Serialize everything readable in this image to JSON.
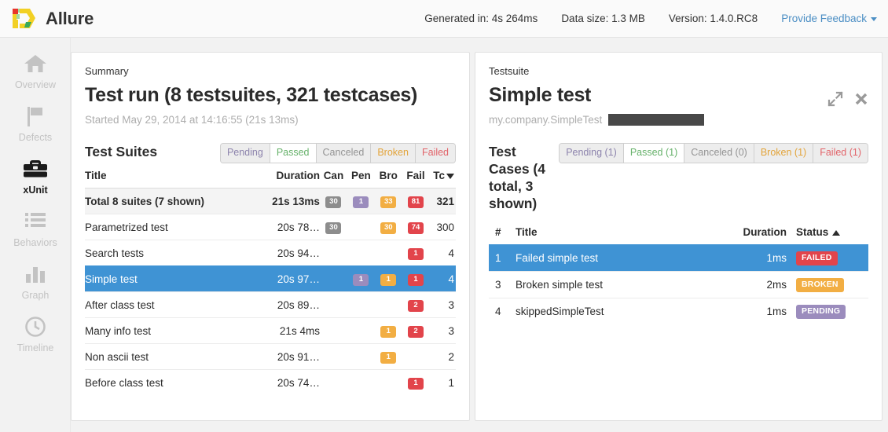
{
  "header": {
    "brand": "Allure",
    "logo_icon": "allure-logo-icon",
    "generated": "Generated in: 4s 264ms",
    "data_size": "Data size: 1.3 MB",
    "version": "Version: 1.4.0.RC8",
    "feedback": "Provide Feedback"
  },
  "sidebar": {
    "items": [
      {
        "label": "Overview",
        "icon": "home-icon",
        "active": false
      },
      {
        "label": "Defects",
        "icon": "flag-icon",
        "active": false
      },
      {
        "label": "xUnit",
        "icon": "briefcase-icon",
        "active": true
      },
      {
        "label": "Behaviors",
        "icon": "list-icon",
        "active": false
      },
      {
        "label": "Graph",
        "icon": "bar-chart-icon",
        "active": false
      },
      {
        "label": "Timeline",
        "icon": "clock-icon",
        "active": false
      }
    ]
  },
  "summary": {
    "eyebrow": "Summary",
    "title": "Test run (8 testsuites, 321 testcases)",
    "subtitle": "Started May 29, 2014 at 14:16:55 (21s 13ms)",
    "section_title": "Test Suites",
    "filters": [
      {
        "label": "Pending",
        "color": "#8d84ad",
        "active": false
      },
      {
        "label": "Passed",
        "color": "#67b26b",
        "active": true
      },
      {
        "label": "Canceled",
        "color": "#949494",
        "active": false
      },
      {
        "label": "Broken",
        "color": "#e3a43a",
        "active": false
      },
      {
        "label": "Failed",
        "color": "#e2646a",
        "active": false
      }
    ],
    "columns": [
      "Title",
      "Duration",
      "Can",
      "Pen",
      "Bro",
      "Fail",
      "Tc"
    ],
    "sort_column": "Tc",
    "sort_direction": "desc",
    "rows": [
      {
        "title": "Total 8 suites (7 shown)",
        "duration": "21s 13ms",
        "canceled": "30",
        "pending": "1",
        "broken": "33",
        "failed": "81",
        "total": "321",
        "total_row": true,
        "selected": false
      },
      {
        "title": "Parametrized test",
        "duration": "20s 78…",
        "canceled": "30",
        "pending": "",
        "broken": "30",
        "failed": "74",
        "total": "300",
        "total_row": false,
        "selected": false
      },
      {
        "title": "Search tests",
        "duration": "20s 94…",
        "canceled": "",
        "pending": "",
        "broken": "",
        "failed": "1",
        "total": "4",
        "total_row": false,
        "selected": false
      },
      {
        "title": "Simple test",
        "duration": "20s 97…",
        "canceled": "",
        "pending": "1",
        "broken": "1",
        "failed": "1",
        "total": "4",
        "total_row": false,
        "selected": true
      },
      {
        "title": "After class test",
        "duration": "20s 89…",
        "canceled": "",
        "pending": "",
        "broken": "",
        "failed": "2",
        "total": "3",
        "total_row": false,
        "selected": false
      },
      {
        "title": "Many info test",
        "duration": "21s 4ms",
        "canceled": "",
        "pending": "",
        "broken": "1",
        "failed": "2",
        "total": "3",
        "total_row": false,
        "selected": false
      },
      {
        "title": "Non ascii test",
        "duration": "20s 91…",
        "canceled": "",
        "pending": "",
        "broken": "1",
        "failed": "",
        "total": "2",
        "total_row": false,
        "selected": false
      },
      {
        "title": "Before class test",
        "duration": "20s 74…",
        "canceled": "",
        "pending": "",
        "broken": "",
        "failed": "1",
        "total": "1",
        "total_row": false,
        "selected": false
      }
    ]
  },
  "detail": {
    "eyebrow": "Testsuite",
    "title": "Simple test",
    "package": "my.company.SimpleTest",
    "redacted": true,
    "expand_icon": "expand-diagonal-icon",
    "close_icon": "close-icon",
    "section_title": "Test Cases (4 total, 3 shown)",
    "filters": [
      {
        "label": "Pending (1)",
        "color": "#8d84ad",
        "active": false
      },
      {
        "label": "Passed (1)",
        "color": "#67b26b",
        "active": true
      },
      {
        "label": "Canceled (0)",
        "color": "#949494",
        "active": false
      },
      {
        "label": "Broken (1)",
        "color": "#e3a43a",
        "active": false
      },
      {
        "label": "Failed (1)",
        "color": "#e2646a",
        "active": false
      }
    ],
    "columns": [
      "#",
      "Title",
      "Duration",
      "Status"
    ],
    "sort_column": "Status",
    "sort_direction": "asc",
    "rows": [
      {
        "num": "1",
        "title": "Failed simple test",
        "duration": "1ms",
        "status": "FAILED",
        "status_kind": "failed",
        "selected": true
      },
      {
        "num": "3",
        "title": "Broken simple test",
        "duration": "2ms",
        "status": "BROKEN",
        "status_kind": "broken",
        "selected": false
      },
      {
        "num": "4",
        "title": "skippedSimpleTest",
        "duration": "1ms",
        "status": "PENDING",
        "status_kind": "pending",
        "selected": false
      }
    ]
  }
}
